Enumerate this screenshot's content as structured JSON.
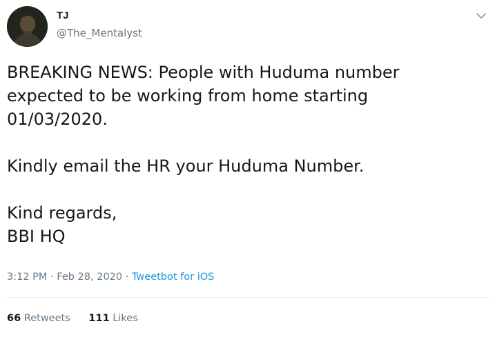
{
  "author": {
    "display_name": "TJ",
    "handle": "@The_Mentalyst"
  },
  "tweet": {
    "lines_1": [
      "BREAKING NEWS: People with Huduma number",
      "expected to be working from home starting",
      "01/03/2020."
    ],
    "lines_2": [
      "Kindly email the HR your Huduma Number."
    ],
    "lines_3": [
      "Kind regards,",
      "BBI HQ"
    ]
  },
  "meta": {
    "time": "3:12 PM",
    "separator": "·",
    "date": "Feb 28, 2020",
    "source": "Tweetbot for iOS"
  },
  "stats": {
    "retweets_count": "66",
    "retweets_label": "Retweets",
    "likes_count": "111",
    "likes_label": "Likes"
  },
  "icons": {
    "menu": "chevron-down-icon"
  },
  "colors": {
    "text": "#14171a",
    "secondary": "#657786",
    "link": "#1b95e0",
    "divider": "#e6ecf0"
  }
}
